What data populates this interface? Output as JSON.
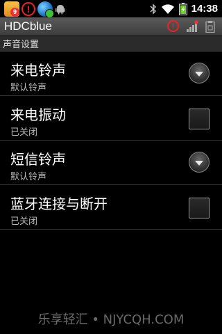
{
  "status_bar": {
    "notification_count": "9",
    "time": "14:38",
    "icons": [
      "app-notification-icon",
      "warning-icon",
      "download-globe-icon",
      "android-debug-icon",
      "bluetooth-icon",
      "wifi-icon",
      "battery-charging-icon"
    ]
  },
  "title_bar": {
    "title": "HDCblue",
    "icons": [
      "alert-icon",
      "signal-icon",
      "clipboard-icon"
    ]
  },
  "section": {
    "header": "声音设置"
  },
  "settings": [
    {
      "title": "来电铃声",
      "summary": "默认铃声",
      "control": "dropdown"
    },
    {
      "title": "来电振动",
      "summary": "已关闭",
      "control": "checkbox",
      "checked": false
    },
    {
      "title": "短信铃声",
      "summary": "默认铃声",
      "control": "dropdown"
    },
    {
      "title": "蓝牙连接与断开",
      "summary": "已关闭",
      "control": "checkbox",
      "checked": false
    }
  ],
  "watermark": "乐享轻汇 • NJYCQH.COM"
}
